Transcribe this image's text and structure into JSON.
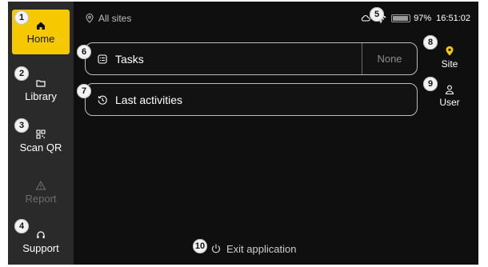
{
  "topbar": {
    "location": "All sites",
    "battery_percent": "97%",
    "battery_level": 0.97,
    "time": "16:51:02"
  },
  "sidebar": {
    "items": [
      {
        "label": "Home",
        "icon": "home-icon",
        "active": true
      },
      {
        "label": "Library",
        "icon": "folder-icon"
      },
      {
        "label": "Scan QR",
        "icon": "qr-code-icon"
      },
      {
        "label": "Report",
        "icon": "warning-icon",
        "disabled": true
      },
      {
        "label": "Support",
        "icon": "headset-icon"
      }
    ]
  },
  "main": {
    "tasks": {
      "label": "Tasks",
      "value": "None",
      "icon": "task-list-icon"
    },
    "activities": {
      "label": "Last activities",
      "icon": "history-icon"
    }
  },
  "right_nav": {
    "site": {
      "label": "Site",
      "icon": "location-pin-icon"
    },
    "user": {
      "label": "User",
      "icon": "user-icon"
    }
  },
  "exit": {
    "label": "Exit application",
    "icon": "power-icon"
  },
  "callouts": [
    "1",
    "2",
    "3",
    "4",
    "5",
    "6",
    "7",
    "8",
    "9",
    "10"
  ],
  "colors": {
    "accent": "#f5c800",
    "background": "#0f0f0f",
    "sidebar": "#2a2a2a"
  }
}
